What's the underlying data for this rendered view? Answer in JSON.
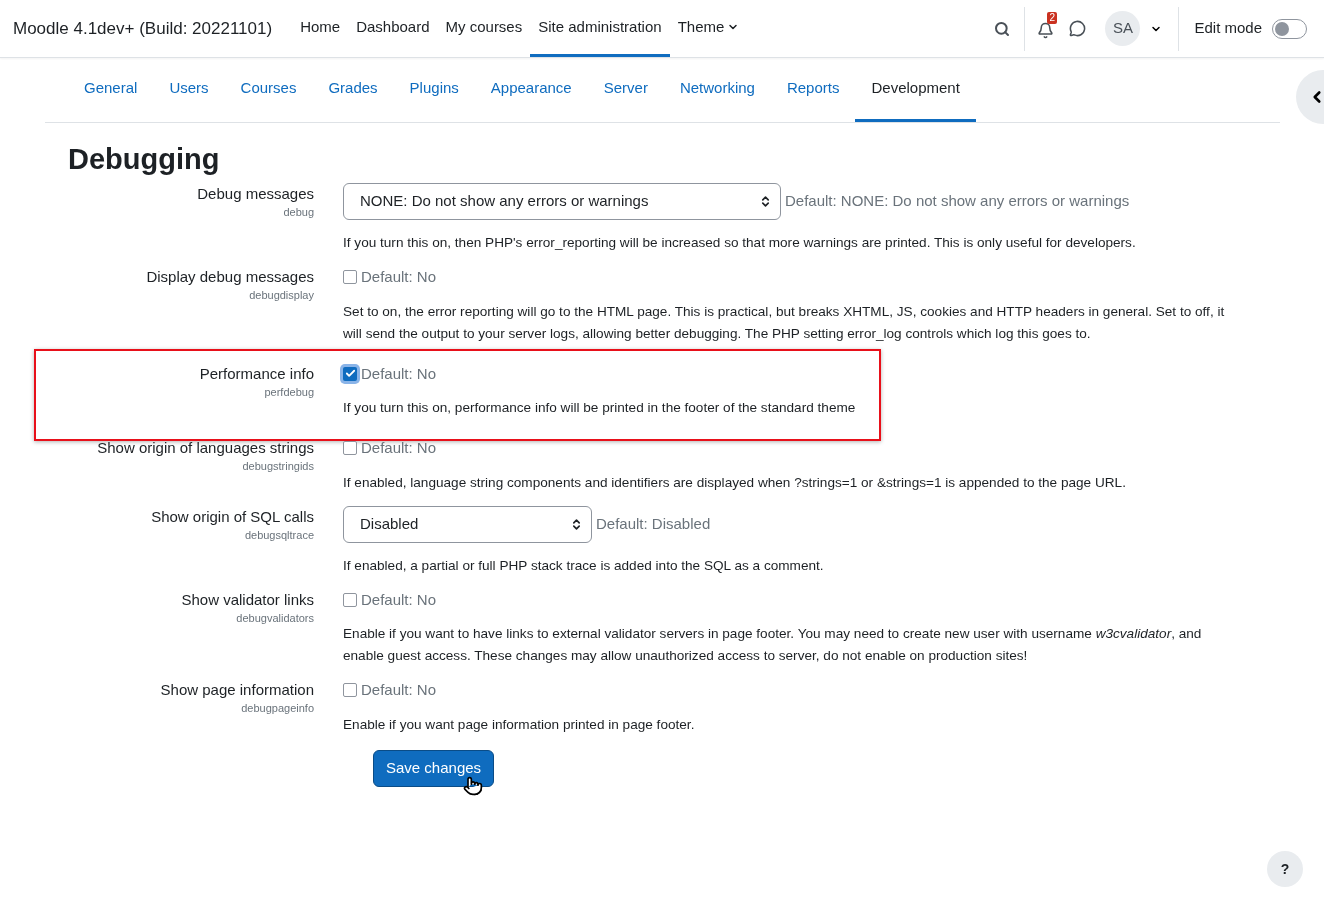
{
  "header": {
    "site_title": "Moodle 4.1dev+ (Build: 20221101)",
    "nav": [
      {
        "label": "Home",
        "selected": false,
        "dropdown": false
      },
      {
        "label": "Dashboard",
        "selected": false,
        "dropdown": false
      },
      {
        "label": "My courses",
        "selected": false,
        "dropdown": false
      },
      {
        "label": "Site administration",
        "selected": true,
        "dropdown": false
      },
      {
        "label": "Theme",
        "selected": false,
        "dropdown": true
      }
    ],
    "notification_count": "2",
    "avatar_initials": "SA",
    "edit_mode": {
      "label": "Edit mode",
      "on": false
    }
  },
  "tabs": [
    {
      "label": "General",
      "selected": false
    },
    {
      "label": "Users",
      "selected": false
    },
    {
      "label": "Courses",
      "selected": false
    },
    {
      "label": "Grades",
      "selected": false
    },
    {
      "label": "Plugins",
      "selected": false
    },
    {
      "label": "Appearance",
      "selected": false
    },
    {
      "label": "Server",
      "selected": false
    },
    {
      "label": "Networking",
      "selected": false
    },
    {
      "label": "Reports",
      "selected": false
    },
    {
      "label": "Development",
      "selected": true
    }
  ],
  "heading": "Debugging",
  "settings": [
    {
      "label": "Debug messages",
      "name": "debug",
      "kind": "select",
      "value": "NONE: Do not show any errors or warnings",
      "default": "Default: NONE: Do not show any errors or warnings",
      "description": "If you turn this on, then PHP's error_reporting will be increased so that more warnings are printed. This is only useful for developers.",
      "highlighted": false
    },
    {
      "label": "Display debug messages",
      "name": "debugdisplay",
      "kind": "checkbox",
      "checked": false,
      "default": "Default: No",
      "description": "Set to on, the error reporting will go to the HTML page. This is practical, but breaks XHTML, JS, cookies and HTTP headers in general. Set to off, it will send the output to your server logs, allowing better debugging. The PHP setting error_log controls which log this goes to.",
      "highlighted": false
    },
    {
      "label": "Performance info",
      "name": "perfdebug",
      "kind": "checkbox",
      "checked": true,
      "default": "Default: No",
      "description": "If you turn this on, performance info will be printed in the footer of the standard theme",
      "highlighted": true
    },
    {
      "label": "Show origin of languages strings",
      "name": "debugstringids",
      "kind": "checkbox",
      "checked": false,
      "default": "Default: No",
      "description": "If enabled, language string components and identifiers are displayed when ?strings=1 or &strings=1 is appended to the page URL.",
      "highlighted": false
    },
    {
      "label": "Show origin of SQL calls",
      "name": "debugsqltrace",
      "kind": "select",
      "value": "Disabled",
      "default": "Default: Disabled",
      "description": "If enabled, a partial or full PHP stack trace is added into the SQL as a comment.",
      "highlighted": false
    },
    {
      "label": "Show validator links",
      "name": "debugvalidators",
      "kind": "checkbox",
      "checked": false,
      "default": "Default: No",
      "description": "Enable if you want to have links to external validator servers in page footer. You may need to create new user with username *w3cvalidator*, and enable guest access. These changes may allow unauthorized access to server, do not enable on production sites!",
      "highlighted": false
    },
    {
      "label": "Show page information",
      "name": "debugpageinfo",
      "kind": "checkbox",
      "checked": false,
      "default": "Default: No",
      "description": "Enable if you want page information printed in page footer.",
      "highlighted": false
    }
  ],
  "save_button": "Save changes",
  "help_button": "?"
}
